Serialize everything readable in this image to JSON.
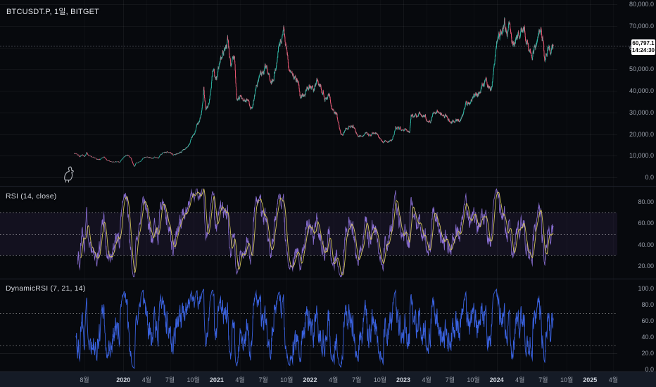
{
  "app": {
    "title": "BTCUSDT.P, 1일, BITGET"
  },
  "panels": {
    "price": {
      "label": "BTCUSDT.P, 1일, BITGET"
    },
    "rsi": {
      "label": "RSI (14, close)"
    },
    "dynrsi": {
      "label": "DynamicRSI (7, 21, 14)"
    }
  },
  "price_marker": {
    "price": "60,797.1",
    "countdown": "14:24:30",
    "value": 60797.1
  },
  "price_scale": {
    "ticks": [
      {
        "text": "80,000.0",
        "v": 80000
      },
      {
        "text": "70,000.0",
        "v": 70000
      },
      {
        "text": "60,000.0",
        "v": 60000
      },
      {
        "text": "50,000.0",
        "v": 50000
      },
      {
        "text": "40,000.0",
        "v": 40000
      },
      {
        "text": "30,000.0",
        "v": 30000
      },
      {
        "text": "20,000.0",
        "v": 20000
      },
      {
        "text": "10,000.0",
        "v": 10000
      },
      {
        "text": "0.0",
        "v": 0
      }
    ]
  },
  "rsi_scale": {
    "ticks": [
      {
        "text": "80.00",
        "v": 80
      },
      {
        "text": "60.00",
        "v": 60
      },
      {
        "text": "40.00",
        "v": 40
      },
      {
        "text": "20.00",
        "v": 20
      }
    ]
  },
  "dynrsi_scale": {
    "ticks": [
      {
        "text": "100.0",
        "v": 100
      },
      {
        "text": "80.0",
        "v": 80
      },
      {
        "text": "60.0",
        "v": 60
      },
      {
        "text": "40.0",
        "v": 40
      },
      {
        "text": "20.0",
        "v": 20
      },
      {
        "text": "0.0",
        "v": 0
      }
    ]
  },
  "time_axis": {
    "labels": [
      {
        "text": "8월",
        "m": 0
      },
      {
        "text": "2020",
        "m": 5,
        "year": true
      },
      {
        "text": "4월",
        "m": 8
      },
      {
        "text": "7월",
        "m": 11
      },
      {
        "text": "10월",
        "m": 14
      },
      {
        "text": "2021",
        "m": 17,
        "year": true
      },
      {
        "text": "4월",
        "m": 20
      },
      {
        "text": "7월",
        "m": 23
      },
      {
        "text": "10월",
        "m": 26
      },
      {
        "text": "2022",
        "m": 29,
        "year": true
      },
      {
        "text": "4월",
        "m": 32
      },
      {
        "text": "7월",
        "m": 35
      },
      {
        "text": "10월",
        "m": 38
      },
      {
        "text": "2023",
        "m": 41,
        "year": true
      },
      {
        "text": "4월",
        "m": 44
      },
      {
        "text": "7월",
        "m": 47
      },
      {
        "text": "10월",
        "m": 50
      },
      {
        "text": "2024",
        "m": 53,
        "year": true
      },
      {
        "text": "4월",
        "m": 56
      },
      {
        "text": "7월",
        "m": 59
      },
      {
        "text": "10월",
        "m": 62
      },
      {
        "text": "2025",
        "m": 65,
        "year": true
      },
      {
        "text": "4월",
        "m": 68
      }
    ]
  },
  "colors": {
    "background": "#07090d",
    "axis_strip": "#151b26",
    "grid": "rgba(255,255,255,0.05)",
    "candle_up": "#2eb9a7",
    "candle_down": "#ef5a77",
    "rsi_line": "#8a6fd4",
    "rsi_ma": "#d1c35c",
    "rsi_band_fill": "rgba(126,87,194,0.10)",
    "dynrsi_line": "#3a62e0",
    "level_dash": "rgba(255,255,255,0.5)",
    "price_line": "rgba(190,195,205,0.35)",
    "tick_text": "#9aa0ab",
    "marker_bg": "#ffffff"
  },
  "chart_data": {
    "type": "candlestick",
    "symbol": "BTCUSDT.P",
    "interval": "1일",
    "exchange": "BITGET",
    "last_price": 60797.1,
    "price_axis_range": [
      0,
      82000
    ],
    "time_range": [
      "2019-06",
      "2025-05"
    ],
    "indicators": [
      {
        "name": "RSI",
        "params": [
          14,
          "close"
        ],
        "levels": [
          70,
          50,
          30
        ],
        "range": [
          0,
          100
        ]
      },
      {
        "name": "DynamicRSI",
        "params": [
          7,
          21,
          14
        ],
        "levels": [
          70,
          30
        ],
        "range": [
          0,
          100
        ]
      }
    ],
    "price_anchors_months_from_aug2019_and_close": [
      [
        -1.35,
        11200
      ],
      [
        -1.0,
        10800
      ],
      [
        -0.6,
        9700
      ],
      [
        -0.3,
        10600
      ],
      [
        0,
        10100
      ],
      [
        0.3,
        11300
      ],
      [
        0.7,
        10200
      ],
      [
        1,
        9600
      ],
      [
        1.5,
        8300
      ],
      [
        2,
        8300
      ],
      [
        2.5,
        9600
      ],
      [
        3,
        7600
      ],
      [
        3.5,
        7300
      ],
      [
        4,
        7200
      ],
      [
        4.5,
        7000
      ],
      [
        5,
        9400
      ],
      [
        5.5,
        10300
      ],
      [
        6,
        8600
      ],
      [
        6.4,
        4900
      ],
      [
        6.6,
        6300
      ],
      [
        7,
        6900
      ],
      [
        7.5,
        8900
      ],
      [
        8,
        9400
      ],
      [
        8.5,
        9000
      ],
      [
        9,
        9100
      ],
      [
        9.5,
        9200
      ],
      [
        10,
        11300
      ],
      [
        10.5,
        11900
      ],
      [
        11,
        11700
      ],
      [
        11.4,
        10300
      ],
      [
        12,
        10800
      ],
      [
        12.5,
        11500
      ],
      [
        13,
        13800
      ],
      [
        13.5,
        15600
      ],
      [
        14,
        19700
      ],
      [
        14.5,
        24000
      ],
      [
        15,
        29000
      ],
      [
        15.35,
        40700
      ],
      [
        15.6,
        31500
      ],
      [
        16,
        33100
      ],
      [
        16.5,
        50000
      ],
      [
        16.8,
        45500
      ],
      [
        17,
        45100
      ],
      [
        17.5,
        57500
      ],
      [
        18,
        58800
      ],
      [
        18.45,
        63200
      ],
      [
        18.8,
        50000
      ],
      [
        19,
        57700
      ],
      [
        19.3,
        55500
      ],
      [
        19.62,
        36500
      ],
      [
        20,
        37300
      ],
      [
        20.5,
        33500
      ],
      [
        21,
        35000
      ],
      [
        21.5,
        31800
      ],
      [
        22,
        41500
      ],
      [
        22.5,
        46500
      ],
      [
        23,
        47100
      ],
      [
        23.45,
        50500
      ],
      [
        23.8,
        44500
      ],
      [
        24,
        43800
      ],
      [
        24.6,
        51000
      ],
      [
        25,
        61300
      ],
      [
        25.35,
        63000
      ],
      [
        25.6,
        67500
      ],
      [
        26,
        57000
      ],
      [
        26.4,
        49500
      ],
      [
        27,
        46200
      ],
      [
        27.5,
        42500
      ],
      [
        27.8,
        35500
      ],
      [
        28,
        38500
      ],
      [
        28.5,
        39800
      ],
      [
        29,
        43200
      ],
      [
        29.5,
        39500
      ],
      [
        30,
        45500
      ],
      [
        30.5,
        41500
      ],
      [
        31,
        37700
      ],
      [
        31.5,
        39000
      ],
      [
        31.8,
        31000
      ],
      [
        32,
        31800
      ],
      [
        32.4,
        29300
      ],
      [
        33,
        19900
      ],
      [
        33.5,
        21300
      ],
      [
        34,
        23300
      ],
      [
        34.5,
        24300
      ],
      [
        35,
        20000
      ],
      [
        35.5,
        19200
      ],
      [
        36,
        19400
      ],
      [
        36.5,
        19300
      ],
      [
        37,
        20500
      ],
      [
        37.5,
        20800
      ],
      [
        38,
        17000
      ],
      [
        38.3,
        16200
      ],
      [
        39,
        16500
      ],
      [
        39.5,
        16800
      ],
      [
        40,
        23100
      ],
      [
        40.5,
        22900
      ],
      [
        41,
        23100
      ],
      [
        41.8,
        20600
      ],
      [
        42,
        28500
      ],
      [
        42.5,
        28200
      ],
      [
        43,
        29200
      ],
      [
        43.5,
        29800
      ],
      [
        44,
        27200
      ],
      [
        44.5,
        26600
      ],
      [
        45,
        30500
      ],
      [
        45.3,
        31000
      ],
      [
        46,
        29200
      ],
      [
        46.5,
        29300
      ],
      [
        47,
        26000
      ],
      [
        47.5,
        26000
      ],
      [
        48,
        26900
      ],
      [
        48.5,
        27200
      ],
      [
        49,
        34600
      ],
      [
        49.5,
        35000
      ],
      [
        50,
        37700
      ],
      [
        50.5,
        37800
      ],
      [
        51,
        42300
      ],
      [
        51.5,
        43800
      ],
      [
        52,
        42600
      ],
      [
        52.3,
        40200
      ],
      [
        53,
        61300
      ],
      [
        53.5,
        67500
      ],
      [
        54,
        71300
      ],
      [
        54.35,
        64800
      ],
      [
        54.65,
        70600
      ],
      [
        55,
        60600
      ],
      [
        55.5,
        63500
      ],
      [
        56,
        67600
      ],
      [
        56.35,
        70800
      ],
      [
        57,
        62700
      ],
      [
        57.55,
        55500
      ],
      [
        58,
        62800
      ],
      [
        58.35,
        67800
      ],
      [
        58.7,
        66500
      ],
      [
        59,
        64600
      ],
      [
        59.18,
        53500
      ],
      [
        59.45,
        56500
      ],
      [
        59.75,
        61000
      ],
      [
        60.0,
        58800
      ],
      [
        60.3,
        60797.1
      ]
    ]
  }
}
